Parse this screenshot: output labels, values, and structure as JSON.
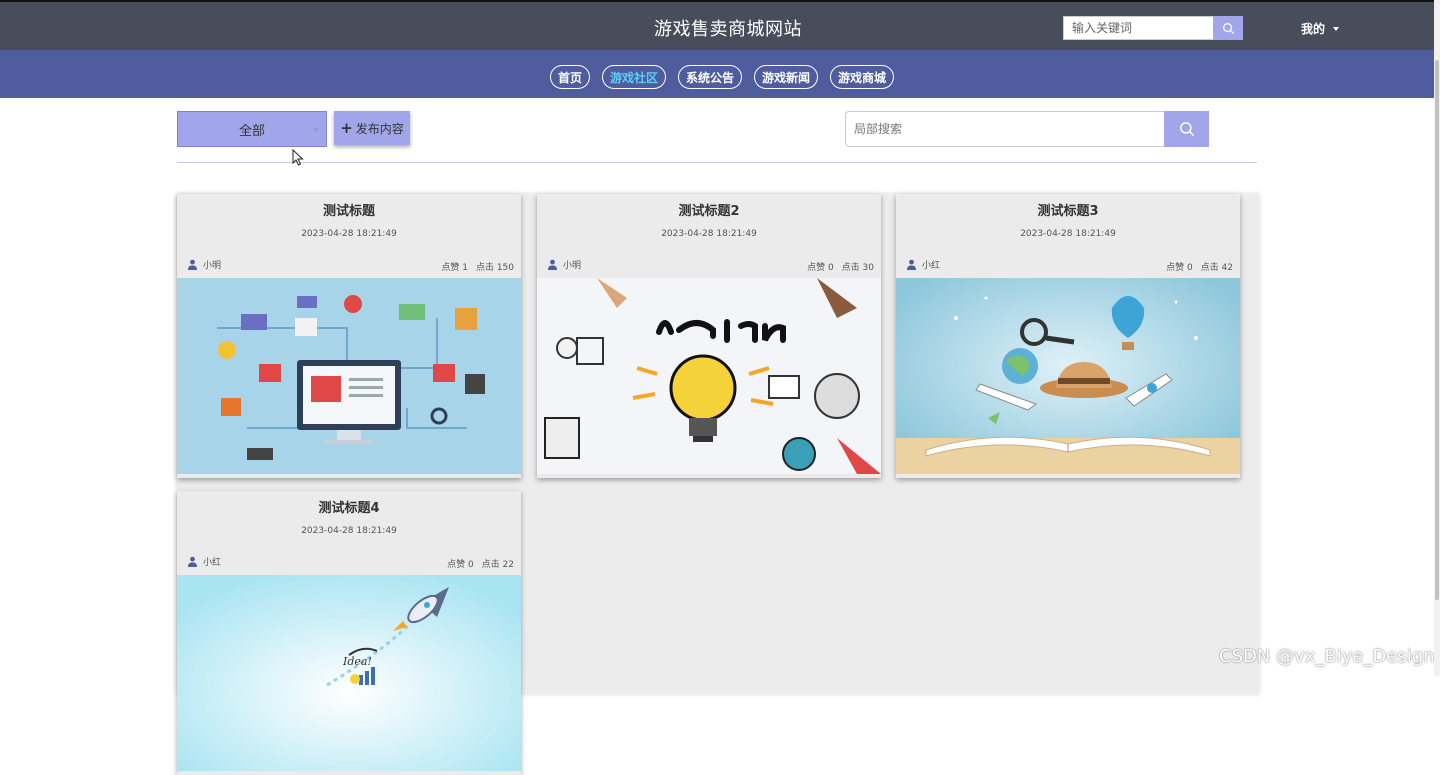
{
  "header": {
    "site_title": "游戏售卖商城网站",
    "keyword_placeholder": "输入关键词",
    "user_menu_label": "我的"
  },
  "nav": {
    "items": [
      {
        "label": "首页",
        "active": false
      },
      {
        "label": "游戏社区",
        "active": true
      },
      {
        "label": "系统公告",
        "active": false
      },
      {
        "label": "游戏新闻",
        "active": false
      },
      {
        "label": "游戏商城",
        "active": false
      }
    ]
  },
  "toolbar": {
    "category_selected": "全部",
    "publish_label": "发布内容",
    "publish_icon": "plus-icon",
    "local_search_placeholder": "局部搜索"
  },
  "posts": [
    {
      "title": "测试标题",
      "date": "2023-04-28 18:21:49",
      "author": "小明",
      "likes_label": "点赞 1",
      "clicks_label": "点击 150",
      "image": "ecommerce-illustration"
    },
    {
      "title": "测试标题2",
      "date": "2023-04-28 18:21:49",
      "author": "小明",
      "likes_label": "点赞 0",
      "clicks_label": "点击 30",
      "image": "learn-lightbulb-illustration"
    },
    {
      "title": "测试标题3",
      "date": "2023-04-28 18:21:49",
      "author": "小红",
      "likes_label": "点赞 0",
      "clicks_label": "点击 42",
      "image": "open-book-travel-illustration"
    },
    {
      "title": "测试标题4",
      "date": "2023-04-28 18:21:49",
      "author": "小红",
      "likes_label": "点赞 0",
      "clicks_label": "点击 22",
      "image": "rocket-idea-illustration"
    }
  ],
  "watermark": "CSDN @vx_Biye_Design",
  "colors": {
    "header_bg": "#474d5a",
    "nav_bg": "#4f5d9f",
    "accent": "#a1a6ea",
    "nav_active_text": "#5ad0f5"
  }
}
